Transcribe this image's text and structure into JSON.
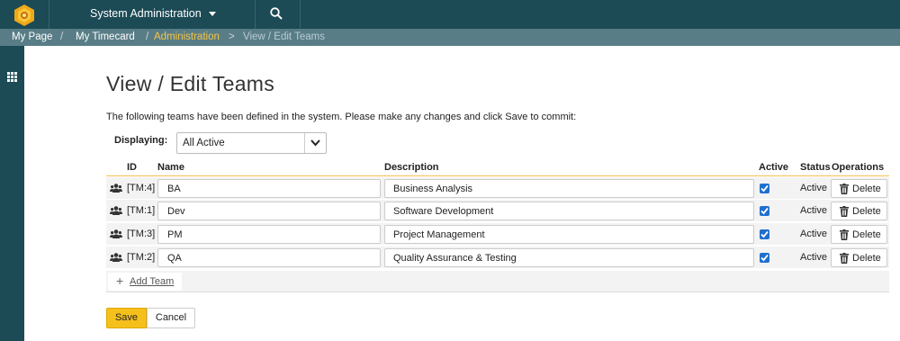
{
  "topbar": {
    "workspace_label": "System Administration",
    "icons": {
      "logo": "spira-logo-icon",
      "caret": "caret-down-icon",
      "search": "search-icon"
    }
  },
  "breadcrumb": {
    "items": [
      {
        "label": "My Page",
        "state": "link"
      },
      {
        "label": "My Timecard",
        "state": "link"
      },
      {
        "label": "Administration",
        "state": "active"
      },
      {
        "label": "View / Edit Teams",
        "state": "current"
      }
    ],
    "separator": "/",
    "chevron": ">"
  },
  "rail": {
    "icon": "app-grid-icon"
  },
  "page": {
    "title": "View / Edit Teams",
    "intro": "The following teams have been defined in the system. Please make any changes and click Save to commit:"
  },
  "filter": {
    "label": "Displaying:",
    "selected": "All Active"
  },
  "table": {
    "headers": {
      "id": "ID",
      "name": "Name",
      "description": "Description",
      "active": "Active",
      "status": "Status",
      "operations": "Operations"
    },
    "rows": [
      {
        "id": "[TM:4]",
        "name": "BA",
        "description": "Business Analysis",
        "active": true,
        "status": "Active",
        "delete_label": "Delete"
      },
      {
        "id": "[TM:1]",
        "name": "Dev",
        "description": "Software Development",
        "active": true,
        "status": "Active",
        "delete_label": "Delete"
      },
      {
        "id": "[TM:3]",
        "name": "PM",
        "description": "Project Management",
        "active": true,
        "status": "Active",
        "delete_label": "Delete"
      },
      {
        "id": "[TM:2]",
        "name": "QA",
        "description": "Quality Assurance & Testing",
        "active": true,
        "status": "Active",
        "delete_label": "Delete"
      }
    ],
    "add_label": "Add Team"
  },
  "actions": {
    "save_label": "Save",
    "cancel_label": "Cancel"
  },
  "colors": {
    "topbar": "#1c4a55",
    "breadcrumb_bar": "#587d87",
    "accent": "#f6c01c",
    "checkbox": "#1f6fd1"
  }
}
